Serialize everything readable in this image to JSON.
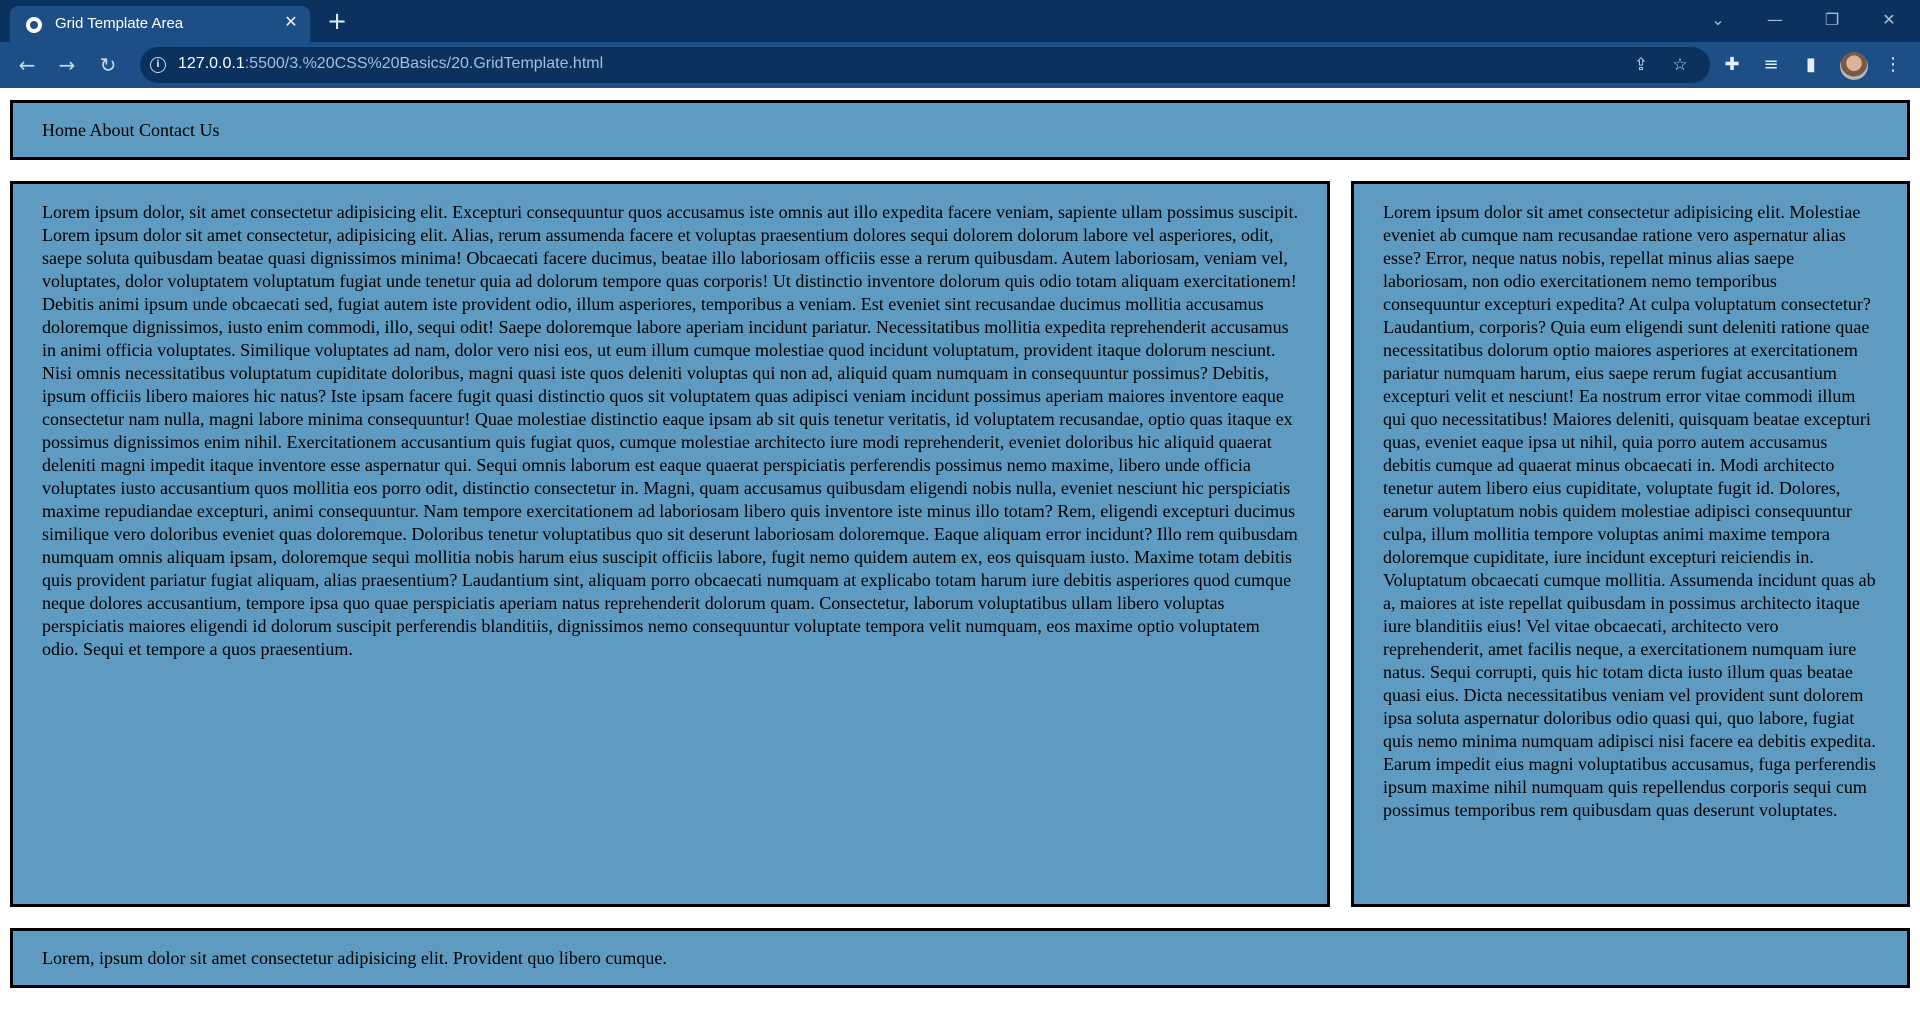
{
  "browser": {
    "tab_title": "Grid Template Area",
    "url_host": "127.0.0.1",
    "url_rest": ":5500/3.%20CSS%20Basics/20.GridTemplate.html",
    "icons": {
      "close": "✕",
      "new_tab": "+",
      "back": "←",
      "forward": "→",
      "reload": "↻",
      "tab_search": "⌄",
      "minimize": "—",
      "restore": "❐",
      "window_close": "✕",
      "share": "⇪",
      "star": "☆",
      "extensions": "✚",
      "media": "≡",
      "sidepanel": "▮",
      "menu": "⋮",
      "info": "i"
    }
  },
  "nav": {
    "links": [
      "Home",
      "About",
      "Contact Us"
    ]
  },
  "main": {
    "text": "Lorem ipsum dolor, sit amet consectetur adipisicing elit. Excepturi consequuntur quos accusamus iste omnis aut illo expedita facere veniam, sapiente ullam possimus suscipit. Lorem ipsum dolor sit amet consectetur, adipisicing elit. Alias, rerum assumenda facere et voluptas praesentium dolores sequi dolorem dolorum labore vel asperiores, odit, saepe soluta quibusdam beatae quasi dignissimos minima! Obcaecati facere ducimus, beatae illo laboriosam officiis esse a rerum quibusdam. Autem laboriosam, veniam vel, voluptates, dolor voluptatem voluptatum fugiat unde tenetur quia ad dolorum tempore quas corporis! Ut distinctio inventore dolorum quis odio totam aliquam exercitationem! Debitis animi ipsum unde obcaecati sed, fugiat autem iste provident odio, illum asperiores, temporibus a veniam. Est eveniet sint recusandae ducimus mollitia accusamus doloremque dignissimos, iusto enim commodi, illo, sequi odit! Saepe doloremque labore aperiam incidunt pariatur. Necessitatibus mollitia expedita reprehenderit accusamus in animi officia voluptates. Similique voluptates ad nam, dolor vero nisi eos, ut eum illum cumque molestiae quod incidunt voluptatum, provident itaque dolorum nesciunt. Nisi omnis necessitatibus voluptatum cupiditate doloribus, magni quasi iste quos deleniti voluptas qui non ad, aliquid quam numquam in consequuntur possimus? Debitis, ipsum officiis libero maiores hic natus? Iste ipsam facere fugit quasi distinctio quos sit voluptatem quas adipisci veniam incidunt possimus aperiam maiores inventore eaque consectetur nam nulla, magni labore minima consequuntur! Quae molestiae distinctio eaque ipsam ab sit quis tenetur veritatis, id voluptatem recusandae, optio quas itaque ex possimus dignissimos enim nihil. Exercitationem accusantium quis fugiat quos, cumque molestiae architecto iure modi reprehenderit, eveniet doloribus hic aliquid quaerat deleniti magni impedit itaque inventore esse aspernatur qui. Sequi omnis laborum est eaque quaerat perspiciatis perferendis possimus nemo maxime, libero unde officia voluptates iusto accusantium quos mollitia eos porro odit, distinctio consectetur in. Magni, quam accusamus quibusdam eligendi nobis nulla, eveniet nesciunt hic perspiciatis maxime repudiandae excepturi, animi consequuntur. Nam tempore exercitationem ad laboriosam libero quis inventore iste minus illo totam? Rem, eligendi excepturi ducimus similique vero doloribus eveniet quas doloremque. Doloribus tenetur voluptatibus quo sit deserunt laboriosam doloremque. Eaque aliquam error incidunt? Illo rem quibusdam numquam omnis aliquam ipsam, doloremque sequi mollitia nobis harum eius suscipit officiis labore, fugit nemo quidem autem ex, eos quisquam iusto. Maxime totam debitis quis provident pariatur fugiat aliquam, alias praesentium? Laudantium sint, aliquam porro obcaecati numquam at explicabo totam harum iure debitis asperiores quod cumque neque dolores accusantium, tempore ipsa quo quae perspiciatis aperiam natus reprehenderit dolorum quam. Consectetur, laborum voluptatibus ullam libero voluptas perspiciatis maiores eligendi id dolorum suscipit perferendis blanditiis, dignissimos nemo consequuntur voluptate tempora velit numquam, eos maxime optio voluptatem odio. Sequi et tempore a quos praesentium."
  },
  "aside": {
    "text": "Lorem ipsum dolor sit amet consectetur adipisicing elit. Molestiae eveniet ab cumque nam recusandae ratione vero aspernatur alias esse? Error, neque natus nobis, repellat minus alias saepe laboriosam, non odio exercitationem nemo temporibus consequuntur excepturi expedita? At culpa voluptatum consectetur? Laudantium, corporis? Quia eum eligendi sunt deleniti ratione quae necessitatibus dolorum optio maiores asperiores at exercitationem pariatur numquam harum, eius saepe rerum fugiat accusantium excepturi velit et nesciunt! Ea nostrum error vitae commodi illum qui quo necessitatibus! Maiores deleniti, quisquam beatae excepturi quas, eveniet eaque ipsa ut nihil, quia porro autem accusamus debitis cumque ad quaerat minus obcaecati in. Modi architecto tenetur autem libero eius cupiditate, voluptate fugit id. Dolores, earum voluptatum nobis quidem molestiae adipisci consequuntur culpa, illum mollitia tempore voluptas animi maxime tempora doloremque cupiditate, iure incidunt excepturi reiciendis in. Voluptatum obcaecati cumque mollitia. Assumenda incidunt quas ab a, maiores at iste repellat quibusdam in possimus architecto itaque iure blanditiis eius! Vel vitae obcaecati, architecto vero reprehenderit, amet facilis neque, a exercitationem numquam iure natus. Sequi corrupti, quis hic totam dicta iusto illum quas beatae quasi eius. Dicta necessitatibus veniam vel provident sunt dolorem ipsa soluta aspernatur doloribus odio quasi qui, quo labore, fugiat quis nemo minima numquam adipisci nisi facere ea debitis expedita. Earum impedit eius magni voluptatibus accusamus, fuga perferendis ipsum maxime nihil numquam quis repellendus corporis sequi cum possimus temporibus rem quibusdam quas deserunt voluptates."
  },
  "footer": {
    "text": "Lorem, ipsum dolor sit amet consectetur adipisicing elit. Provident quo libero cumque."
  },
  "colors": {
    "tabbar_bg": "#0b325e",
    "toolbar_bg": "#1d4f86",
    "box_bg": "#5f9bc0",
    "box_border": "#000000"
  }
}
